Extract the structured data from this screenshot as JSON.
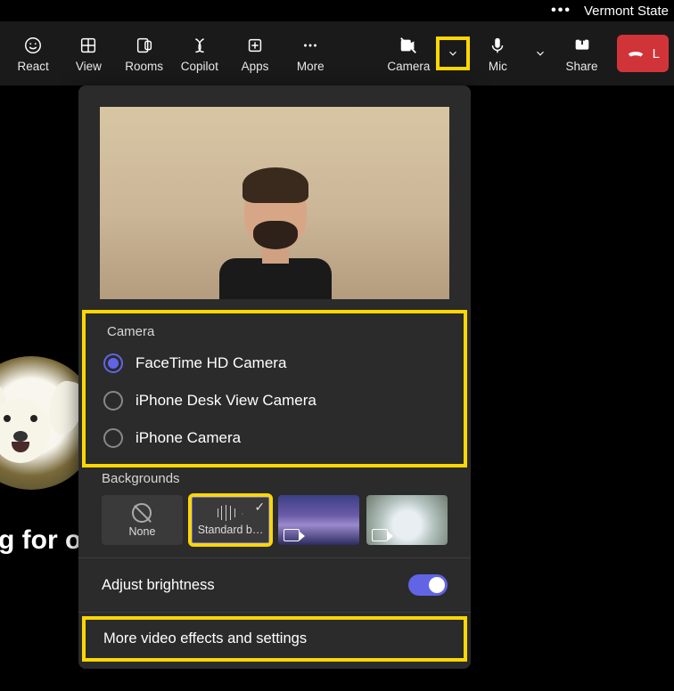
{
  "header": {
    "title": "Vermont State"
  },
  "toolbar": {
    "react": "React",
    "view": "View",
    "rooms": "Rooms",
    "copilot": "Copilot",
    "apps": "Apps",
    "more": "More",
    "camera": "Camera",
    "mic": "Mic",
    "share": "Share",
    "leave": "L"
  },
  "waiting_text": "g for ot",
  "panel": {
    "camera_label": "Camera",
    "cameras": [
      {
        "name": "FaceTime HD Camera",
        "selected": true
      },
      {
        "name": "iPhone Desk View Camera",
        "selected": false
      },
      {
        "name": "iPhone Camera",
        "selected": false
      }
    ],
    "backgrounds_label": "Backgrounds",
    "bg_none": "None",
    "bg_blur": "Standard b…",
    "brightness_label": "Adjust brightness",
    "brightness_on": true,
    "more_effects": "More video effects and settings"
  }
}
